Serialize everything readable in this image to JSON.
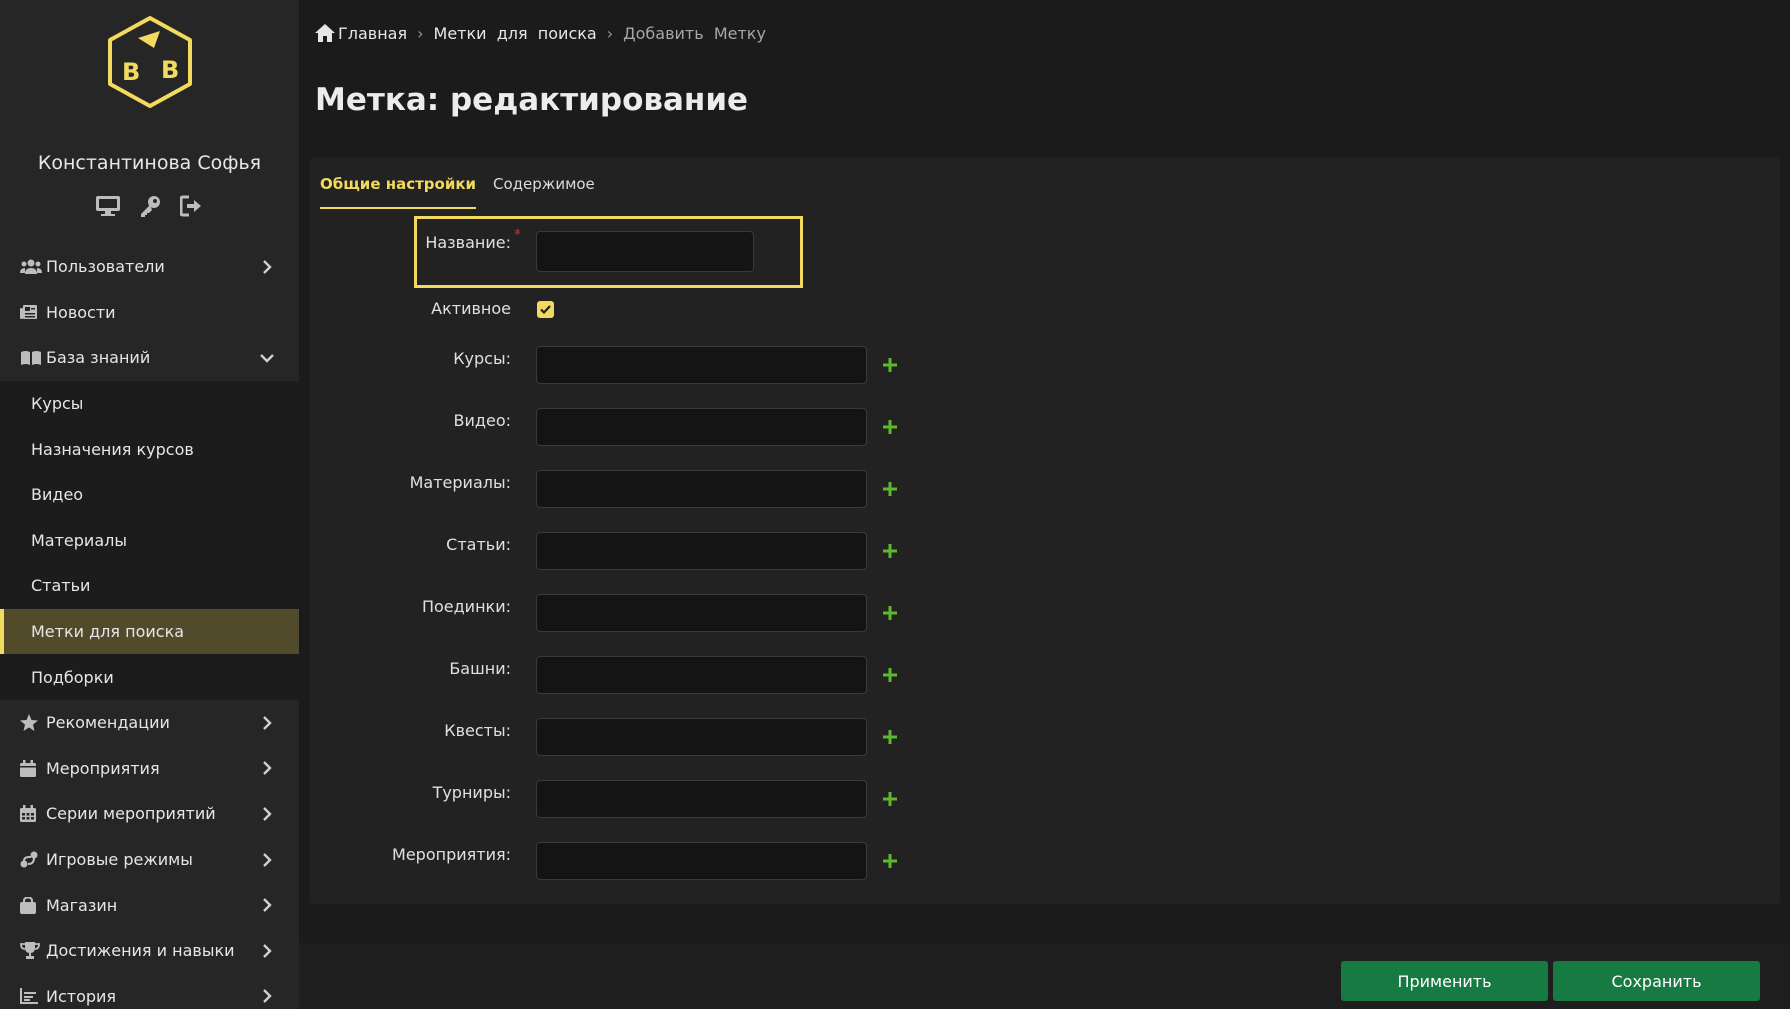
{
  "user": {
    "name": "Константинова Софья"
  },
  "user_icons": [
    "monitor-icon",
    "key-icon",
    "sign-out-icon"
  ],
  "sidebar": {
    "items": [
      {
        "label": "Пользователи",
        "icon": "users-icon",
        "chevron": "right"
      },
      {
        "label": "Новости",
        "icon": "newspaper-icon",
        "chevron": ""
      },
      {
        "label": "База знаний",
        "icon": "book-icon",
        "chevron": "down"
      }
    ],
    "sub_items": [
      {
        "label": "Курсы"
      },
      {
        "label": "Назначения курсов"
      },
      {
        "label": "Видео"
      },
      {
        "label": "Материалы"
      },
      {
        "label": "Статьи"
      },
      {
        "label": "Метки для поиска",
        "active": true
      },
      {
        "label": "Подборки"
      }
    ],
    "items_after": [
      {
        "label": "Рекомендации",
        "icon": "star-icon",
        "chevron": "right"
      },
      {
        "label": "Мероприятия",
        "icon": "calendar-icon",
        "chevron": "right"
      },
      {
        "label": "Серии мероприятий",
        "icon": "calendar-grid-icon",
        "chevron": "right"
      },
      {
        "label": "Игровые режимы",
        "icon": "route-icon",
        "chevron": "right"
      },
      {
        "label": "Магазин",
        "icon": "shopping-bag-icon",
        "chevron": "right"
      },
      {
        "label": "Достижения и навыки",
        "icon": "trophy-icon",
        "chevron": "right"
      },
      {
        "label": "История",
        "icon": "chart-icon",
        "chevron": "right"
      }
    ]
  },
  "breadcrumb": {
    "home": "Главная",
    "section": "Метки  для  поиска",
    "current": "Добавить  Метку"
  },
  "page_title": "Метка: редактирование",
  "tabs": [
    {
      "label": "Общие настройки",
      "active": true
    },
    {
      "label": "Содержимое",
      "active": false
    }
  ],
  "form": {
    "name_label": "Название:",
    "name_value": "",
    "required_mark": "*",
    "active_label": "Активное",
    "active_checked": true,
    "fields": [
      {
        "label": "Курсы:",
        "value": ""
      },
      {
        "label": "Видео:",
        "value": ""
      },
      {
        "label": "Материалы:",
        "value": ""
      },
      {
        "label": "Статьи:",
        "value": ""
      },
      {
        "label": "Поединки:",
        "value": ""
      },
      {
        "label": "Башни:",
        "value": ""
      },
      {
        "label": "Квесты:",
        "value": ""
      },
      {
        "label": "Турниры:",
        "value": ""
      },
      {
        "label": "Мероприятия:",
        "value": ""
      }
    ]
  },
  "footer": {
    "apply_label": "Применить",
    "save_label": "Сохранить"
  },
  "colors": {
    "accent": "#f2da5f",
    "button_green": "#187a43",
    "plus_green": "#5cb82d",
    "required_red": "#e02b2b"
  }
}
